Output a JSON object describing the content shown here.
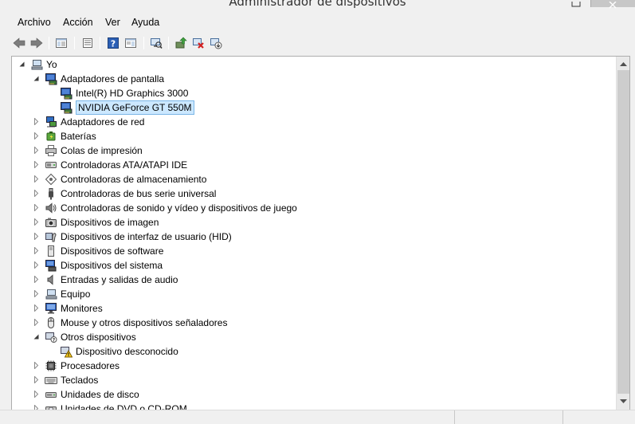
{
  "window": {
    "title": "Administrador de dispositivos"
  },
  "menu": [
    "Archivo",
    "Acción",
    "Ver",
    "Ayuda"
  ],
  "toolbar": {
    "buttons": [
      "back-arrow-icon",
      "forward-arrow-icon",
      "show-hide-tree-icon",
      "properties-icon",
      "help-icon",
      "action-pane-icon",
      "scan-hardware-icon",
      "update-driver-icon",
      "uninstall-device-icon",
      "disable-device-icon"
    ]
  },
  "tree": {
    "root": "Yo",
    "items": [
      {
        "label": "Adaptadores de pantalla",
        "level": 1,
        "expanded": true,
        "icon": "display-adapter-icon"
      },
      {
        "label": "Intel(R) HD Graphics 3000",
        "level": 2,
        "icon": "display-adapter-icon"
      },
      {
        "label": "NVIDIA GeForce GT 550M",
        "level": 2,
        "icon": "display-adapter-icon",
        "selected": true
      },
      {
        "label": "Adaptadores de red",
        "level": 1,
        "icon": "network-adapter-icon"
      },
      {
        "label": "Baterías",
        "level": 1,
        "icon": "battery-icon"
      },
      {
        "label": "Colas de impresión",
        "level": 1,
        "icon": "printer-icon"
      },
      {
        "label": "Controladoras ATA/ATAPI IDE",
        "level": 1,
        "icon": "ide-controller-icon"
      },
      {
        "label": "Controladoras de almacenamiento",
        "level": 1,
        "icon": "storage-controller-icon"
      },
      {
        "label": "Controladoras de bus serie universal",
        "level": 1,
        "icon": "usb-icon"
      },
      {
        "label": "Controladoras de sonido y vídeo y dispositivos de juego",
        "level": 1,
        "icon": "sound-icon"
      },
      {
        "label": "Dispositivos de imagen",
        "level": 1,
        "icon": "camera-icon"
      },
      {
        "label": "Dispositivos de interfaz de usuario (HID)",
        "level": 1,
        "icon": "hid-icon"
      },
      {
        "label": "Dispositivos de software",
        "level": 1,
        "icon": "software-device-icon"
      },
      {
        "label": "Dispositivos del sistema",
        "level": 1,
        "icon": "system-device-icon"
      },
      {
        "label": "Entradas y salidas de audio",
        "level": 1,
        "icon": "audio-io-icon"
      },
      {
        "label": "Equipo",
        "level": 1,
        "icon": "computer-icon"
      },
      {
        "label": "Monitores",
        "level": 1,
        "icon": "monitor-icon"
      },
      {
        "label": "Mouse y otros dispositivos señaladores",
        "level": 1,
        "icon": "mouse-icon"
      },
      {
        "label": "Otros dispositivos",
        "level": 1,
        "expanded": true,
        "icon": "unknown-device-icon"
      },
      {
        "label": "Dispositivo desconocido",
        "level": 2,
        "icon": "warning-device-icon"
      },
      {
        "label": "Procesadores",
        "level": 1,
        "icon": "processor-icon"
      },
      {
        "label": "Teclados",
        "level": 1,
        "icon": "keyboard-icon"
      },
      {
        "label": "Unidades de disco",
        "level": 1,
        "icon": "disk-drive-icon"
      },
      {
        "label": "Unidades de DVD o CD-ROM",
        "level": 1,
        "icon": "dvd-drive-icon"
      }
    ]
  },
  "colors": {
    "selection_bg": "#cce8ff",
    "selection_border": "#7ab6e6",
    "window_bg": "#f0f0f0"
  }
}
